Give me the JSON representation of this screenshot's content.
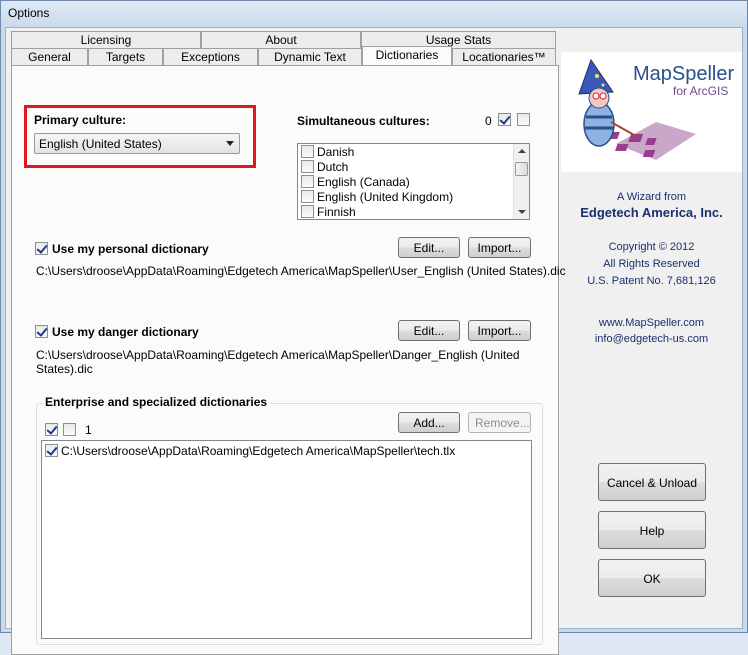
{
  "window": {
    "title": "Options"
  },
  "tabs": {
    "row1": [
      {
        "label": "Licensing"
      },
      {
        "label": "About"
      },
      {
        "label": "Usage Stats"
      }
    ],
    "row2": [
      {
        "label": "General"
      },
      {
        "label": "Targets"
      },
      {
        "label": "Exceptions"
      },
      {
        "label": "Dynamic Text"
      },
      {
        "label": "Dictionaries"
      },
      {
        "label": "Locationaries™"
      }
    ],
    "active": "Dictionaries"
  },
  "primary_culture": {
    "label": "Primary culture:",
    "selected": "English (United States)"
  },
  "simultaneous": {
    "label": "Simultaneous cultures:",
    "count": "0",
    "items": [
      {
        "label": "Danish"
      },
      {
        "label": "Dutch"
      },
      {
        "label": "English (Canada)"
      },
      {
        "label": "English (United Kingdom)"
      },
      {
        "label": "Finnish"
      }
    ]
  },
  "personal": {
    "label": "Use my personal dictionary",
    "path": "C:\\Users\\droose\\AppData\\Roaming\\Edgetech America\\MapSpeller\\User_English (United States).dic",
    "edit_label": "Edit...",
    "import_label": "Import..."
  },
  "danger": {
    "label": "Use my danger dictionary",
    "path_line1": "C:\\Users\\droose\\AppData\\Roaming\\Edgetech America\\MapSpeller\\Danger_English (United",
    "path_line2": "States).dic",
    "edit_label": "Edit...",
    "import_label": "Import..."
  },
  "enterprise": {
    "title": "Enterprise and specialized dictionaries",
    "add_label": "Add...",
    "remove_label": "Remove...",
    "count": "1",
    "items": [
      {
        "path": "C:\\Users\\droose\\AppData\\Roaming\\Edgetech America\\MapSpeller\\tech.tlx"
      }
    ]
  },
  "sidebar": {
    "logo_name": "MapSpeller",
    "logo_sub": "for ArcGIS",
    "wizard_line": "A Wizard from",
    "company": "Edgetech America, Inc.",
    "copyright": "Copyright © 2012",
    "rights": "All Rights Reserved",
    "patent": "U.S. Patent No. 7,681,126",
    "website": "www.MapSpeller.com",
    "email": "info@edgetech-us.com",
    "cancel_label": "Cancel & Unload",
    "help_label": "Help",
    "ok_label": "OK"
  },
  "colors": {
    "highlight_box": "#e0181f",
    "brand_text": "#1a2f6e",
    "logo_purple": "#8a3d8f"
  }
}
